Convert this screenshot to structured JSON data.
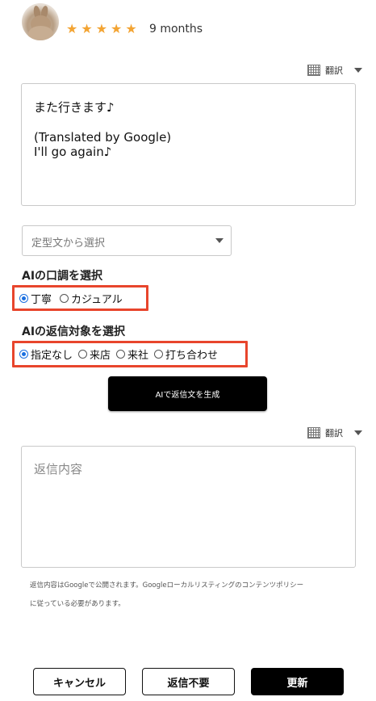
{
  "reviewer": {
    "rating_stars": "★★★★★",
    "rating": 5,
    "age": "9 months"
  },
  "translate_label": "翻訳",
  "review": {
    "line1": "また行きます♪",
    "line2": "(Translated by Google)",
    "line3": "I'll go again♪"
  },
  "template_select": {
    "placeholder": "定型文から選択"
  },
  "tone": {
    "heading": "AIの口調を選択",
    "options": [
      "丁寧",
      "カジュアル"
    ],
    "selected": "丁寧"
  },
  "target": {
    "heading": "AIの返信対象を選択",
    "options": [
      "指定なし",
      "来店",
      "来社",
      "打ち合わせ"
    ],
    "selected": "指定なし"
  },
  "generate_button": "AIで返信文を生成",
  "reply": {
    "placeholder": "返信内容"
  },
  "note": {
    "line1": "返信内容はGoogleで公開されます。Googleローカルリスティングのコンテンツポリシー",
    "line2": "に従っている必要があります。"
  },
  "footer": {
    "cancel": "キャンセル",
    "no_reply": "返信不要",
    "update": "更新"
  },
  "colors": {
    "star": "#f3a433",
    "highlight_border": "#e8452c",
    "radio_selected": "#1a6fe0"
  }
}
